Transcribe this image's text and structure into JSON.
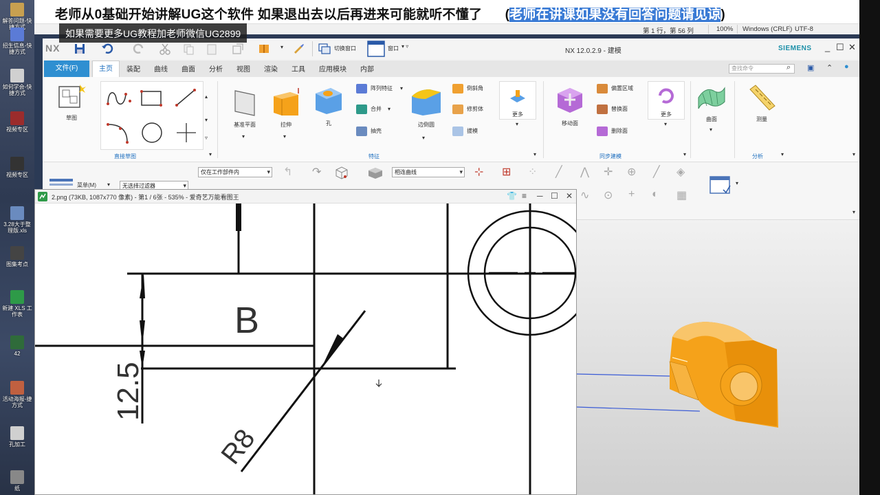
{
  "desktop": {
    "icons": [
      {
        "label": "解答问题-快捷方式",
        "color": "#c8a050"
      },
      {
        "label": "招生信息-快捷方式",
        "color": "#5b7bd6"
      },
      {
        "label": "如何学会-快捷方式",
        "color": "#d0d0d0"
      },
      {
        "label": "视频专区",
        "color": "#9b2c2c"
      },
      {
        "label": "视频专区",
        "color": "#333"
      },
      {
        "label": "3.28大于整理版.xls",
        "color": "#6a8bbf"
      },
      {
        "label": "图集考点",
        "color": "#444"
      },
      {
        "label": "新建 XLS 工作表",
        "color": "#2e9a48"
      },
      {
        "label": "42",
        "color": "#2f6b3a"
      },
      {
        "label": "活动海报-捷方式",
        "color": "#c06040"
      },
      {
        "label": "孔加工",
        "color": "#d0d0d0"
      },
      {
        "label": "纸",
        "color": "#888"
      }
    ]
  },
  "notepad": {
    "title_main": "老师从0基础开始讲解UG这个软件  如果退出去以后再进来可能就听不懂了",
    "title_paren_open": "(",
    "title_highlight": "老师在讲课如果没有回答问题请见谅",
    "title_paren_close": ")",
    "status": {
      "position": "第 1 行，第 56 列",
      "zoom": "100%",
      "eol": "Windows (CRLF)",
      "encoding": "UTF-8"
    }
  },
  "banner": "如果需要更多UG教程加老师微信UG2899",
  "nx": {
    "logo": "NX",
    "caption": "NX 12.0.2.9 - 建模",
    "brand": "SIEMENS",
    "quick_access": {
      "switch_window": "切换窗口",
      "window": "窗口"
    },
    "tabs": [
      "文件(F)",
      "主页",
      "装配",
      "曲线",
      "曲面",
      "分析",
      "视图",
      "渲染",
      "工具",
      "应用模块",
      "内部"
    ],
    "command_finder": "查找命令",
    "ribbon": {
      "sketch": "草图",
      "direct_sketch_group": "直接草图",
      "datum_plane": "基准平面",
      "extrude": "拉伸",
      "hole": "孔",
      "pattern_feature": "阵列特征",
      "unite": "合并",
      "shell": "抽壳",
      "edge_blend": "边倒圆",
      "chamfer": "倒斜角",
      "trim_body": "修剪体",
      "draft": "拔模",
      "more": "更多",
      "feature_group": "特征",
      "move_face": "移动面",
      "offset_region": "偏置区域",
      "replace_face": "替换面",
      "delete_face": "删除面",
      "sync_group": "同步建模",
      "surface": "曲面",
      "measure": "测量",
      "analysis_group": "分析"
    },
    "toolbar2": {
      "menu": "菜单(M)",
      "filter": "无选择过滤器",
      "scope": "仅在工作部件内",
      "curve_rule": "相连曲线"
    }
  },
  "viewer": {
    "title": "2.png (73KB, 1087x770 像素) - 第1 / 6张 - 535% - 爱奇艺万能看图王",
    "drawing": {
      "label_b": "B",
      "dim_12_5": "12.5",
      "dim_r8": "R8"
    }
  },
  "colors": {
    "accent": "#2f8fd1",
    "part_orange": "#f5a21a",
    "highlight": "#3a7bd5"
  }
}
